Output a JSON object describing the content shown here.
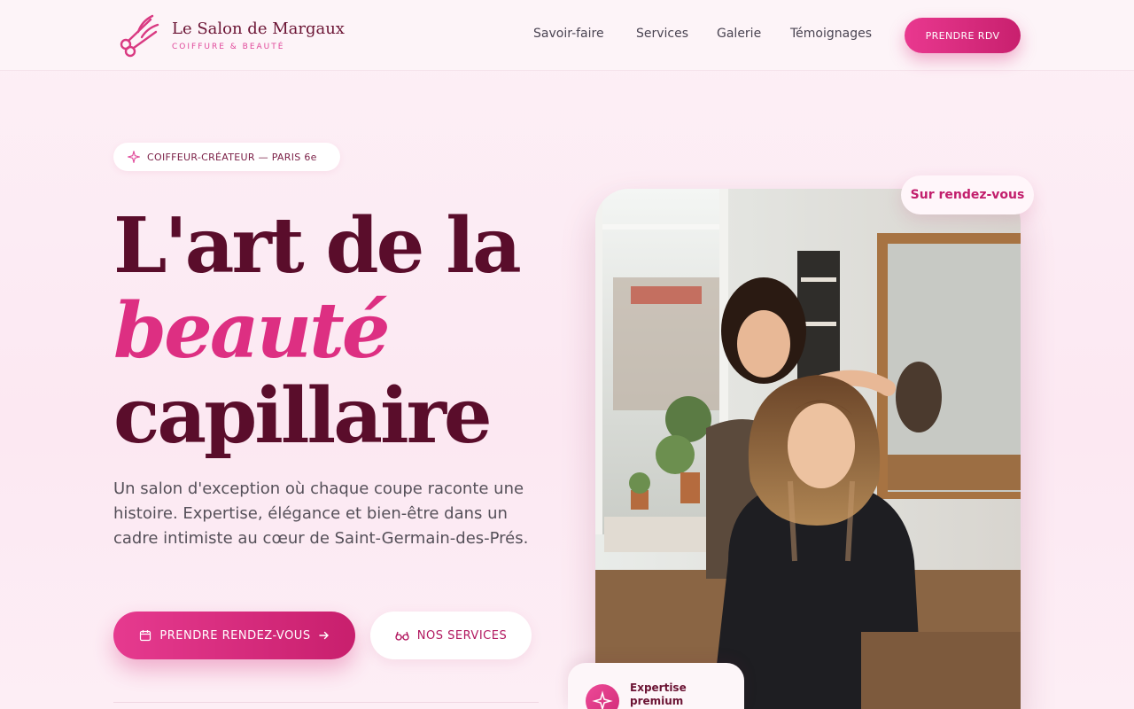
{
  "header": {
    "brand_name": "Le Salon de Margaux",
    "brand_tagline": "COIFFURE & BEAUTÉ",
    "logo_icon": "scissors-icon",
    "nav": [
      {
        "label": "Savoir-faire"
      },
      {
        "label": "Services"
      },
      {
        "label": "Galerie"
      },
      {
        "label": "Témoignages"
      }
    ],
    "cta_label": "PRENDRE RDV"
  },
  "hero": {
    "eyebrow": "COIFFEUR-CRÉATEUR — PARIS 6e",
    "eyebrow_icon": "sparkle-icon",
    "title_line1": "L'art de la",
    "title_accent": "beauté",
    "title_line3": "capillaire",
    "lede": "Un salon d'exception où chaque coupe raconte une histoire. Expertise, élégance et bien-être dans un cadre intimiste au cœur de Saint-Germain-des-Prés.",
    "primary_button": "PRENDRE RENDEZ-VOUS",
    "primary_icon": "calendar-icon",
    "secondary_button": "NOS SERVICES",
    "secondary_icon": "glasses-icon",
    "badge": "Sur rendez-vous",
    "card_text": "Expertise premium",
    "card_icon": "sparkle-icon"
  },
  "colors": {
    "accent": "#dd2f82",
    "brand_dark": "#5a0d2b",
    "background": "#fdf0f6"
  }
}
